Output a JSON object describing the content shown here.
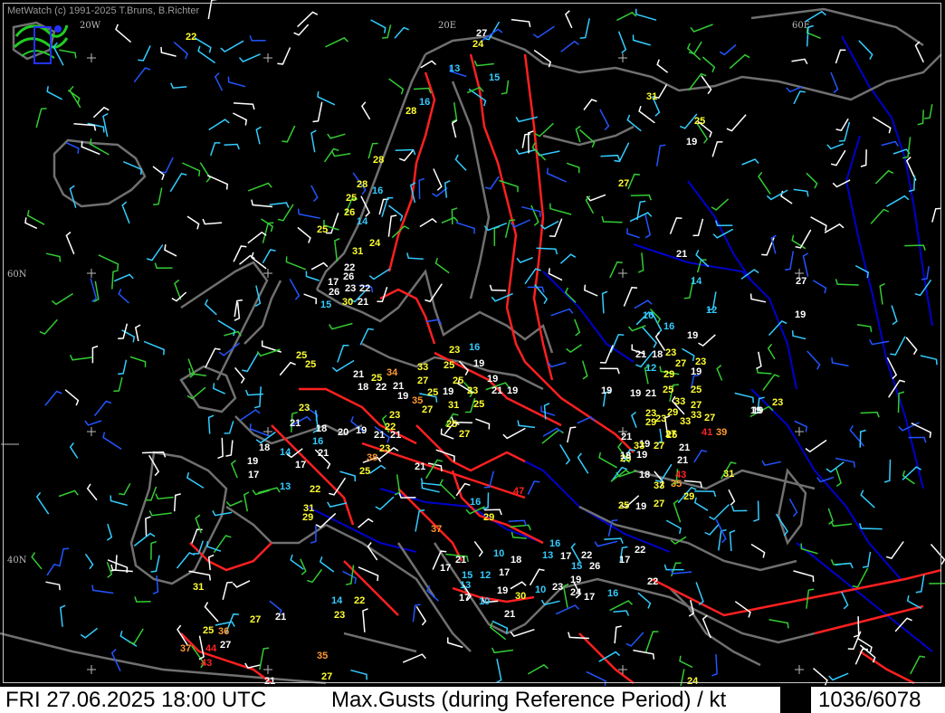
{
  "copyright": "MetWatch  (c) 1991-2025 T.Bruns, B.Richter",
  "bottom_bar": {
    "datetime": "FRI 27.06.2025 18:00 UTC",
    "parameter": "Max.Gusts (during Reference Period) / kt",
    "station_count": "1036/6078"
  },
  "graticule_labels": [
    {
      "text": "20W"
    },
    {
      "text": "20E"
    },
    {
      "text": "60E"
    },
    {
      "text": "60N"
    },
    {
      "text": "40N"
    }
  ],
  "colors": {
    "white": "#ffffff",
    "yellow": "#ffff33",
    "cyan": "#33ccff",
    "orange": "#ff9933",
    "red": "#ff2222",
    "border_red": "#ff2020",
    "coast": "#707070",
    "river": "#0000cc"
  },
  "gust_stations": [
    {
      "v": "22",
      "c": "yellow"
    },
    {
      "v": "27",
      "c": "white"
    },
    {
      "v": "24",
      "c": "yellow"
    },
    {
      "v": "13",
      "c": "cyan"
    },
    {
      "v": "15",
      "c": "cyan"
    },
    {
      "v": "16",
      "c": "cyan"
    },
    {
      "v": "28",
      "c": "yellow"
    },
    {
      "v": "31",
      "c": "yellow"
    },
    {
      "v": "25",
      "c": "yellow"
    },
    {
      "v": "19",
      "c": "white"
    },
    {
      "v": "28",
      "c": "yellow"
    },
    {
      "v": "27",
      "c": "yellow"
    },
    {
      "v": "28",
      "c": "yellow"
    },
    {
      "v": "16",
      "c": "cyan"
    },
    {
      "v": "25",
      "c": "yellow"
    },
    {
      "v": "26",
      "c": "yellow"
    },
    {
      "v": "14",
      "c": "cyan"
    },
    {
      "v": "25",
      "c": "yellow"
    },
    {
      "v": "24",
      "c": "yellow"
    },
    {
      "v": "31",
      "c": "yellow"
    },
    {
      "v": "21",
      "c": "white"
    },
    {
      "v": "22",
      "c": "white"
    },
    {
      "v": "17",
      "c": "white"
    },
    {
      "v": "26",
      "c": "white"
    },
    {
      "v": "26",
      "c": "white"
    },
    {
      "v": "23",
      "c": "white"
    },
    {
      "v": "22",
      "c": "white"
    },
    {
      "v": "14",
      "c": "cyan"
    },
    {
      "v": "15",
      "c": "cyan"
    },
    {
      "v": "30",
      "c": "yellow"
    },
    {
      "v": "21",
      "c": "white"
    },
    {
      "v": "12",
      "c": "cyan"
    },
    {
      "v": "16",
      "c": "cyan"
    },
    {
      "v": "19",
      "c": "white"
    },
    {
      "v": "16",
      "c": "cyan"
    },
    {
      "v": "19",
      "c": "white"
    },
    {
      "v": "16",
      "c": "cyan"
    },
    {
      "v": "23",
      "c": "yellow"
    },
    {
      "v": "19",
      "c": "white"
    },
    {
      "v": "25",
      "c": "yellow"
    },
    {
      "v": "25",
      "c": "yellow"
    },
    {
      "v": "33",
      "c": "yellow"
    },
    {
      "v": "25",
      "c": "yellow"
    },
    {
      "v": "19",
      "c": "white"
    },
    {
      "v": "21",
      "c": "white"
    },
    {
      "v": "34",
      "c": "orange"
    },
    {
      "v": "18",
      "c": "white"
    },
    {
      "v": "22",
      "c": "white"
    },
    {
      "v": "25",
      "c": "yellow"
    },
    {
      "v": "21",
      "c": "white"
    },
    {
      "v": "19",
      "c": "white"
    },
    {
      "v": "27",
      "c": "yellow"
    },
    {
      "v": "25",
      "c": "yellow"
    },
    {
      "v": "25",
      "c": "yellow"
    },
    {
      "v": "19",
      "c": "white"
    },
    {
      "v": "23",
      "c": "yellow"
    },
    {
      "v": "21",
      "c": "white"
    },
    {
      "v": "19",
      "c": "white"
    },
    {
      "v": "35",
      "c": "orange"
    },
    {
      "v": "27",
      "c": "yellow"
    },
    {
      "v": "31",
      "c": "yellow"
    },
    {
      "v": "25",
      "c": "yellow"
    },
    {
      "v": "19",
      "c": "white"
    },
    {
      "v": "21",
      "c": "white"
    },
    {
      "v": "18",
      "c": "white"
    },
    {
      "v": "23",
      "c": "yellow"
    },
    {
      "v": "19",
      "c": "white"
    },
    {
      "v": "12",
      "c": "cyan"
    },
    {
      "v": "29",
      "c": "yellow"
    },
    {
      "v": "27",
      "c": "yellow"
    },
    {
      "v": "23",
      "c": "yellow"
    },
    {
      "v": "21",
      "c": "white"
    },
    {
      "v": "25",
      "c": "yellow"
    },
    {
      "v": "19",
      "c": "white"
    },
    {
      "v": "33",
      "c": "yellow"
    },
    {
      "v": "25",
      "c": "yellow"
    },
    {
      "v": "27",
      "c": "yellow"
    },
    {
      "v": "29",
      "c": "yellow"
    },
    {
      "v": "23",
      "c": "yellow"
    },
    {
      "v": "19",
      "c": "white"
    },
    {
      "v": "23",
      "c": "yellow"
    },
    {
      "v": "21",
      "c": "white"
    },
    {
      "v": "18",
      "c": "white"
    },
    {
      "v": "16",
      "c": "cyan"
    },
    {
      "v": "20",
      "c": "white"
    },
    {
      "v": "19",
      "c": "white"
    },
    {
      "v": "23",
      "c": "yellow"
    },
    {
      "v": "22",
      "c": "yellow"
    },
    {
      "v": "21",
      "c": "white"
    },
    {
      "v": "21",
      "c": "white"
    },
    {
      "v": "25",
      "c": "yellow"
    },
    {
      "v": "27",
      "c": "yellow"
    },
    {
      "v": "21",
      "c": "white"
    },
    {
      "v": "18",
      "c": "white"
    },
    {
      "v": "19",
      "c": "white"
    },
    {
      "v": "14",
      "c": "cyan"
    },
    {
      "v": "17",
      "c": "white"
    },
    {
      "v": "17",
      "c": "white"
    },
    {
      "v": "21",
      "c": "white"
    },
    {
      "v": "38",
      "c": "orange"
    },
    {
      "v": "23",
      "c": "yellow"
    },
    {
      "v": "25",
      "c": "yellow"
    },
    {
      "v": "21",
      "c": "white"
    },
    {
      "v": "25",
      "c": "yellow"
    },
    {
      "v": "19",
      "c": "white"
    },
    {
      "v": "33",
      "c": "yellow"
    },
    {
      "v": "27",
      "c": "yellow"
    },
    {
      "v": "23",
      "c": "yellow"
    },
    {
      "v": "33",
      "c": "yellow"
    },
    {
      "v": "27",
      "c": "yellow"
    },
    {
      "v": "41",
      "c": "red"
    },
    {
      "v": "39",
      "c": "orange"
    },
    {
      "v": "19",
      "c": "white"
    },
    {
      "v": "23",
      "c": "yellow"
    },
    {
      "v": "29",
      "c": "yellow"
    },
    {
      "v": "21",
      "c": "white"
    },
    {
      "v": "27",
      "c": "yellow"
    },
    {
      "v": "33",
      "c": "yellow"
    },
    {
      "v": "25",
      "c": "yellow"
    },
    {
      "v": "21",
      "c": "white"
    },
    {
      "v": "33",
      "c": "yellow"
    },
    {
      "v": "35",
      "c": "orange"
    },
    {
      "v": "43",
      "c": "red"
    },
    {
      "v": "31",
      "c": "yellow"
    },
    {
      "v": "18",
      "c": "white"
    },
    {
      "v": "19",
      "c": "white"
    },
    {
      "v": "18",
      "c": "white"
    },
    {
      "v": "13",
      "c": "cyan"
    },
    {
      "v": "22",
      "c": "yellow"
    },
    {
      "v": "47",
      "c": "red"
    },
    {
      "v": "16",
      "c": "cyan"
    },
    {
      "v": "29",
      "c": "yellow"
    },
    {
      "v": "31",
      "c": "yellow"
    },
    {
      "v": "29",
      "c": "yellow"
    },
    {
      "v": "25",
      "c": "yellow"
    },
    {
      "v": "19",
      "c": "white"
    },
    {
      "v": "27",
      "c": "yellow"
    },
    {
      "v": "29",
      "c": "yellow"
    },
    {
      "v": "37",
      "c": "orange"
    },
    {
      "v": "16",
      "c": "cyan"
    },
    {
      "v": "13",
      "c": "cyan"
    },
    {
      "v": "17",
      "c": "white"
    },
    {
      "v": "22",
      "c": "white"
    },
    {
      "v": "15",
      "c": "cyan"
    },
    {
      "v": "26",
      "c": "white"
    },
    {
      "v": "17",
      "c": "white"
    },
    {
      "v": "22",
      "c": "white"
    },
    {
      "v": "10",
      "c": "cyan"
    },
    {
      "v": "18",
      "c": "white"
    },
    {
      "v": "21",
      "c": "white"
    },
    {
      "v": "17",
      "c": "white"
    },
    {
      "v": "15",
      "c": "cyan"
    },
    {
      "v": "12",
      "c": "cyan"
    },
    {
      "v": "17",
      "c": "white"
    },
    {
      "v": "19",
      "c": "white"
    },
    {
      "v": "13",
      "c": "cyan"
    },
    {
      "v": "19",
      "c": "white"
    },
    {
      "v": "30",
      "c": "yellow"
    },
    {
      "v": "10",
      "c": "cyan"
    },
    {
      "v": "23",
      "c": "white"
    },
    {
      "v": "24",
      "c": "white"
    },
    {
      "v": "17",
      "c": "white"
    },
    {
      "v": "16",
      "c": "cyan"
    },
    {
      "v": "22",
      "c": "white"
    },
    {
      "v": "17",
      "c": "white"
    },
    {
      "v": "10",
      "c": "cyan"
    },
    {
      "v": "21",
      "c": "white"
    },
    {
      "v": "31",
      "c": "yellow"
    },
    {
      "v": "14",
      "c": "cyan"
    },
    {
      "v": "22",
      "c": "yellow"
    },
    {
      "v": "27",
      "c": "yellow"
    },
    {
      "v": "21",
      "c": "white"
    },
    {
      "v": "23",
      "c": "yellow"
    },
    {
      "v": "25",
      "c": "yellow"
    },
    {
      "v": "36",
      "c": "orange"
    },
    {
      "v": "37",
      "c": "orange"
    },
    {
      "v": "44",
      "c": "red"
    },
    {
      "v": "27",
      "c": "white"
    },
    {
      "v": "43",
      "c": "red"
    },
    {
      "v": "35",
      "c": "orange"
    },
    {
      "v": "21",
      "c": "white"
    },
    {
      "v": "27",
      "c": "yellow"
    },
    {
      "v": "24",
      "c": "yellow"
    },
    {
      "v": "27",
      "c": "white"
    },
    {
      "v": "19",
      "c": "white"
    }
  ]
}
